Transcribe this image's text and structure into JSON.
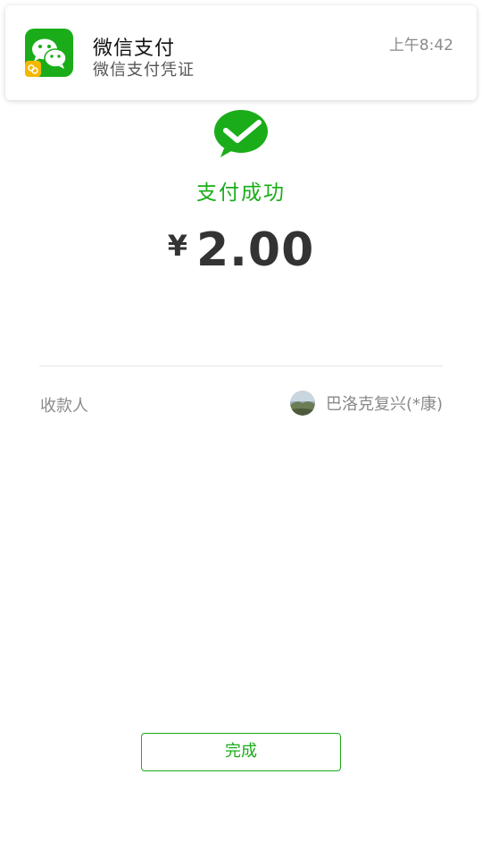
{
  "notification": {
    "app_name": "微信支付",
    "time": "上午8:42",
    "message": "微信支付凭证",
    "icon": "wechat-icon"
  },
  "payment": {
    "status_text": "支付成功",
    "currency_symbol": "¥",
    "amount": "2.00",
    "status_icon": "wechat-pay-check-icon"
  },
  "payee": {
    "label": "收款人",
    "name": "巴洛克复兴(*康)"
  },
  "actions": {
    "done_label": "完成"
  },
  "colors": {
    "brand_green": "#1aad19",
    "text_dark": "#333333",
    "text_muted": "#8a8a8a"
  }
}
